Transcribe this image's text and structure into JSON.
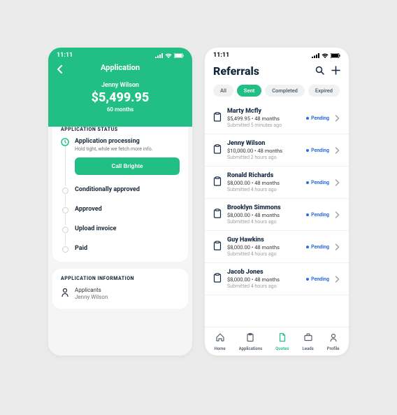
{
  "common": {
    "time": "11:11"
  },
  "app": {
    "header": {
      "title": "Application",
      "applicant": "Jenny Wilson",
      "amount": "$5,499.95",
      "term": "60 months"
    },
    "status": {
      "section_label": "APPLICATION STATUS",
      "cta_label": "Call Brighte",
      "steps": [
        {
          "title": "Application processing",
          "subtitle": "Hold tight, while we fetch more info.",
          "active": true
        },
        {
          "title": "Conditionally approved"
        },
        {
          "title": "Approved"
        },
        {
          "title": "Upload invoice"
        },
        {
          "title": "Paid"
        }
      ]
    },
    "info": {
      "section_label": "APPLICATION INFORMATION",
      "applicants_label": "Applicants",
      "applicants_value": "Jenny Wilson"
    }
  },
  "referrals": {
    "title": "Referrals",
    "filters": [
      "All",
      "Sent",
      "Completed",
      "Expired"
    ],
    "active_filter": "Sent",
    "items": [
      {
        "name": "Marty Mcfly",
        "amount": "$5,499.95",
        "term": "48 months",
        "submitted": "Submitted 5 minutes ago",
        "status": "Pending"
      },
      {
        "name": "Jenny Wilson",
        "amount": "$10,000.00",
        "term": "48 months",
        "submitted": "Submitted 2 hours ago",
        "status": "Pending"
      },
      {
        "name": "Ronald Richards",
        "amount": "$8,000.00",
        "term": "48 months",
        "submitted": "Submitted 4 hours ago",
        "status": "Pending"
      },
      {
        "name": "Brooklyn Simmons",
        "amount": "$8,000.00",
        "term": "48 months",
        "submitted": "Submitted 4 hours ago",
        "status": "Pending"
      },
      {
        "name": "Guy Hawkins",
        "amount": "$8,000.00",
        "term": "48 months",
        "submitted": "Submitted 4 hours ago",
        "status": "Pending"
      },
      {
        "name": "Jacob Jones",
        "amount": "$8,000.00",
        "term": "48 months",
        "submitted": "Submitted 4 hours ago",
        "status": "Pending"
      }
    ],
    "nav": [
      {
        "label": "Home",
        "icon": "home-icon"
      },
      {
        "label": "Applications",
        "icon": "clipboard-icon"
      },
      {
        "label": "Quotes",
        "icon": "document-icon",
        "active": true
      },
      {
        "label": "Leads",
        "icon": "briefcase-icon"
      },
      {
        "label": "Profile",
        "icon": "person-icon"
      }
    ]
  },
  "colors": {
    "accent": "#21bf85",
    "status_blue": "#2d6cdf"
  }
}
